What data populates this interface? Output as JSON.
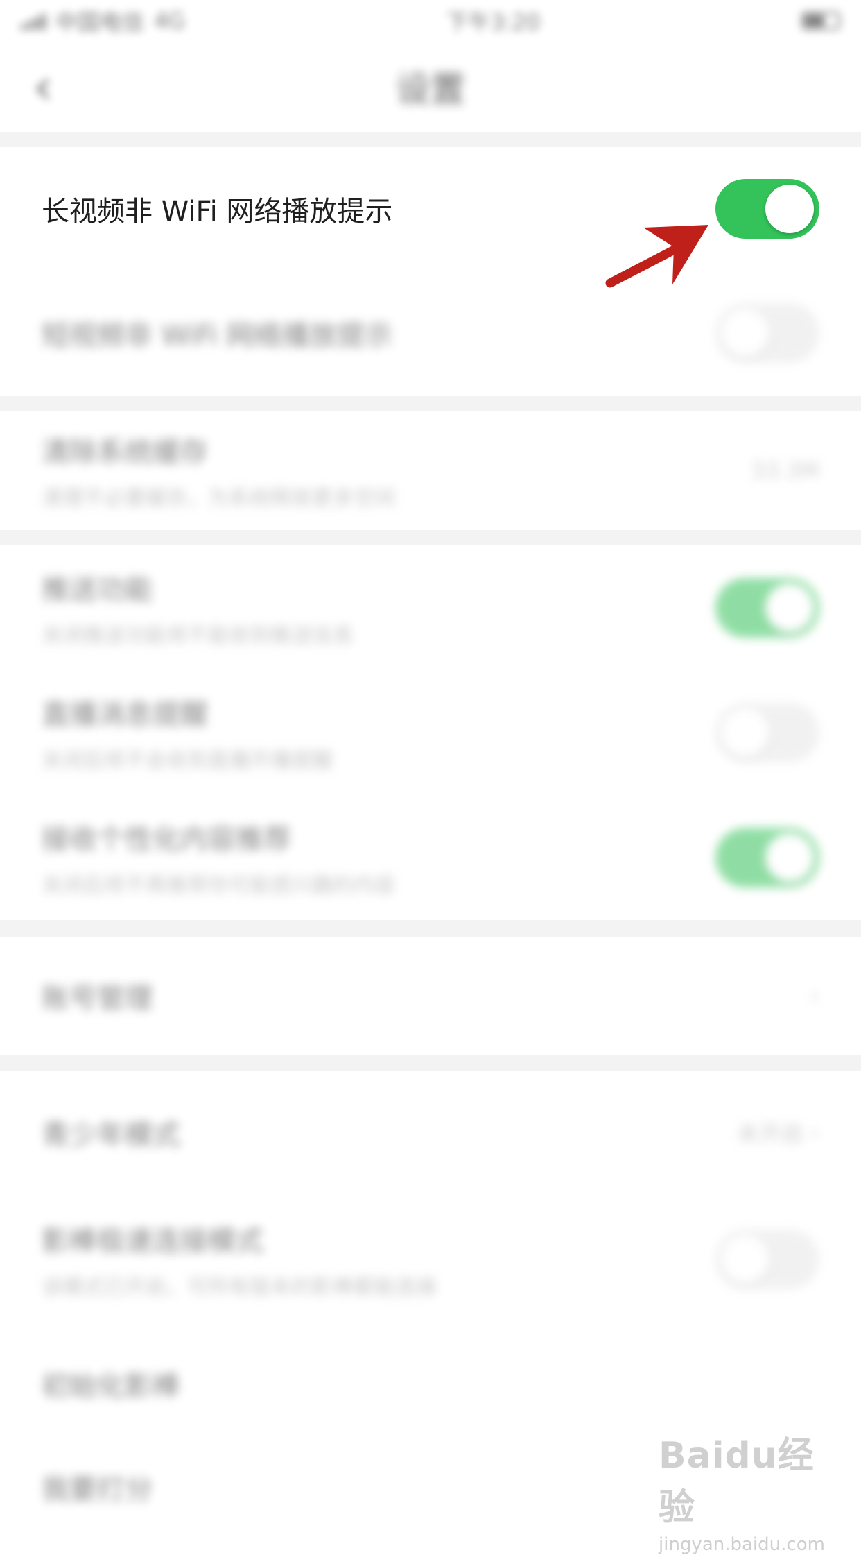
{
  "status_bar": {
    "carrier": "中国电信",
    "network": "4G",
    "time": "下午3:20"
  },
  "nav": {
    "title": "设置",
    "back_icon": "chevron-left-icon"
  },
  "settings": {
    "long_video_prompt": {
      "label": "长视频非 WiFi 网络播放提示",
      "enabled": true
    },
    "short_video_prompt": {
      "label": "短视频非 WiFi 网络播放提示",
      "enabled": false
    },
    "clear_cache": {
      "label": "清除系统缓存",
      "sub": "清理不必要缓存，为系统释放更多空间",
      "value": "33.3M"
    },
    "push": {
      "label": "推送功能",
      "sub": "关闭推送功能将不能收到推送信息",
      "enabled": true
    },
    "live_reminder": {
      "label": "直播消息提醒",
      "sub": "关闭后将不会收到直播开播提醒",
      "enabled": false
    },
    "personalized": {
      "label": "接收个性化内容推荐",
      "sub": "关闭后将不再推荐你可能感兴趣的内容",
      "enabled": true
    },
    "account": {
      "label": "账号管理"
    },
    "teen_mode": {
      "label": "青少年模式",
      "value": "未开启"
    },
    "fast_connect": {
      "label": "影棒极速连接模式",
      "sub": "该模式已开启，可所有版本的影棒都能连接",
      "enabled": false
    },
    "init_device": {
      "label": "初始化影棒"
    },
    "rating": {
      "label": "我要打分"
    }
  },
  "watermark": {
    "logo": "Baidu经验",
    "url": "jingyan.baidu.com"
  },
  "colors": {
    "toggle_on": "#34c35a",
    "arrow": "#c0201a"
  }
}
